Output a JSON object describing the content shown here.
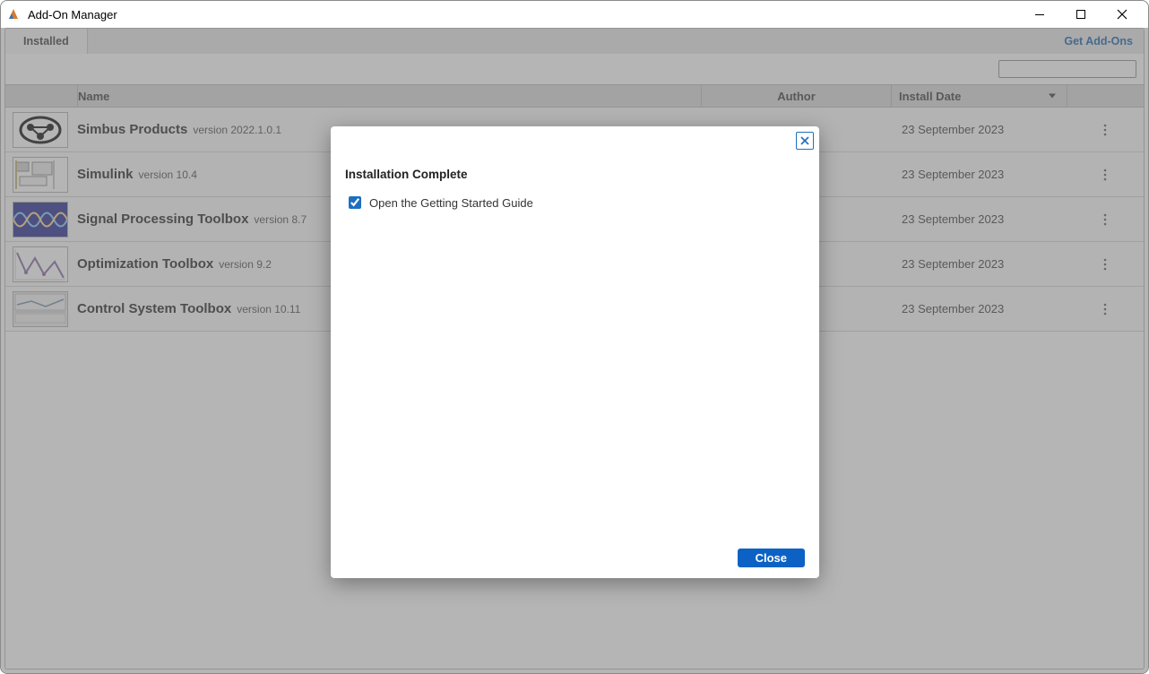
{
  "window": {
    "title": "Add-On Manager"
  },
  "tabs": {
    "installed_label": "Installed",
    "get_addons_label": "Get Add-Ons"
  },
  "table": {
    "headers": {
      "name": "Name",
      "author": "Author",
      "install_date": "Install Date"
    },
    "rows": [
      {
        "name": "Simbus Products",
        "version": "version 2022.1.0.1",
        "author": "",
        "date": "23 September 2023"
      },
      {
        "name": "Simulink",
        "version": "version 10.4",
        "author": "",
        "date": "23 September 2023"
      },
      {
        "name": "Signal Processing Toolbox",
        "version": "version 8.7",
        "author": "",
        "date": "23 September 2023"
      },
      {
        "name": "Optimization Toolbox",
        "version": "version 9.2",
        "author": "",
        "date": "23 September 2023"
      },
      {
        "name": "Control System Toolbox",
        "version": "version 10.11",
        "author": "",
        "date": "23 September 2023"
      }
    ]
  },
  "dialog": {
    "title": "Installation Complete",
    "checkbox_label": "Open the Getting Started Guide",
    "checkbox_checked": true,
    "close_button": "Close"
  },
  "search": {
    "placeholder": ""
  }
}
